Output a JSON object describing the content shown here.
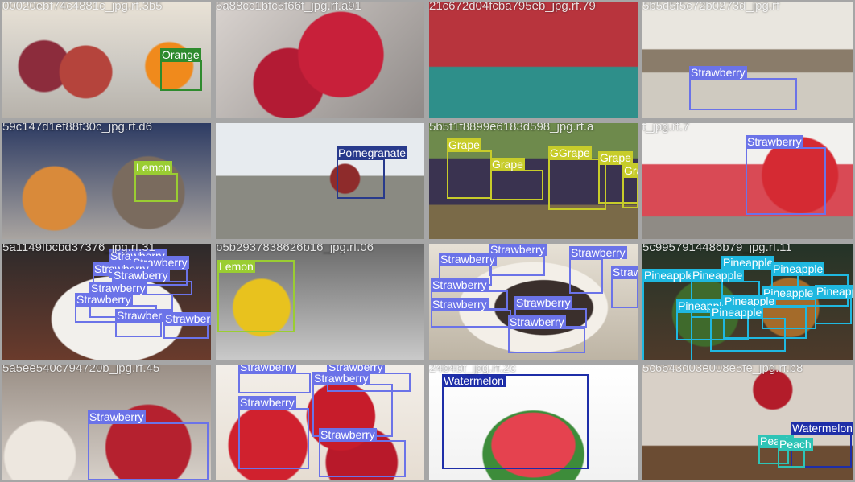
{
  "colors": {
    "orange": "#2e8b2e",
    "strawberry": "#6b73e8",
    "lemon": "#9acd32",
    "pomegranate": "#283a8c",
    "grape": "#c7cc2a",
    "pineapple": "#1fb8e0",
    "watermelon": "#1e2ea8",
    "peach": "#2ec4b6"
  },
  "tiles": [
    {
      "name": "00020ebf74c4881c_jpg.rf.3b5",
      "labels": [
        "Orange"
      ]
    },
    {
      "name": "5a88cc1bfc5f66f_jpg.rf.a91",
      "labels": []
    },
    {
      "name": "21c672d04fcba795eb_jpg.rf.79",
      "labels": []
    },
    {
      "name": "5b5d5f5c72b0273d_jpg.rf",
      "labels": [
        "Strawberry"
      ]
    },
    {
      "name": "59c147d1ef88f30c_jpg.rf.d6",
      "labels": [
        "Lemon"
      ]
    },
    {
      "name": "",
      "labels": [
        "Pomegranate"
      ]
    },
    {
      "name": "5b5f1f8899e6183d598_jpg.rf.a",
      "labels": [
        "Grape",
        "Grape",
        "GGrape",
        "Grape",
        "Grape"
      ]
    },
    {
      "name": "t_jpg.rf.7",
      "labels": [
        "Strawberry"
      ]
    },
    {
      "name": "5a1149fbcbd37376_jpg.rf.31",
      "labels": [
        "Strawberry",
        "Strawberry",
        "Strawberry",
        "Strawberry",
        "Strawberry",
        "Strawberry",
        "Strawberry",
        "Strawberry"
      ]
    },
    {
      "name": "b5b2937838626b16_jpg.rf.06",
      "labels": [
        "Lemon"
      ]
    },
    {
      "name": "",
      "labels": [
        "Strawberry",
        "Strawberry",
        "Strawberry",
        "Strawberry",
        "Strawberry",
        "Strawberry",
        "Strawberry",
        "Strawberry"
      ]
    },
    {
      "name": "5c9957914486b79_jpg.rf.11",
      "labels": [
        "Pineapple",
        "Pineapple",
        "Pineapple",
        "Pineapple",
        "Pineapple",
        "Pineapple",
        "Pineapple",
        "Pineapple",
        "Pineapple"
      ]
    },
    {
      "name": "5a5ee540c794720b_jpg.rf.45",
      "labels": [
        "Strawberry"
      ]
    },
    {
      "name": "",
      "labels": [
        "Strawberry",
        "Strawberry",
        "Strawberry",
        "Strawberry",
        "Strawberry"
      ]
    },
    {
      "name": "24b4bf_jpg.rf.2c",
      "labels": [
        "Watermelon"
      ]
    },
    {
      "name": "5c6643d03e008e5fe_jpg.rf.b8",
      "labels": [
        "Watermelon",
        "Peach",
        "Peach"
      ]
    }
  ]
}
